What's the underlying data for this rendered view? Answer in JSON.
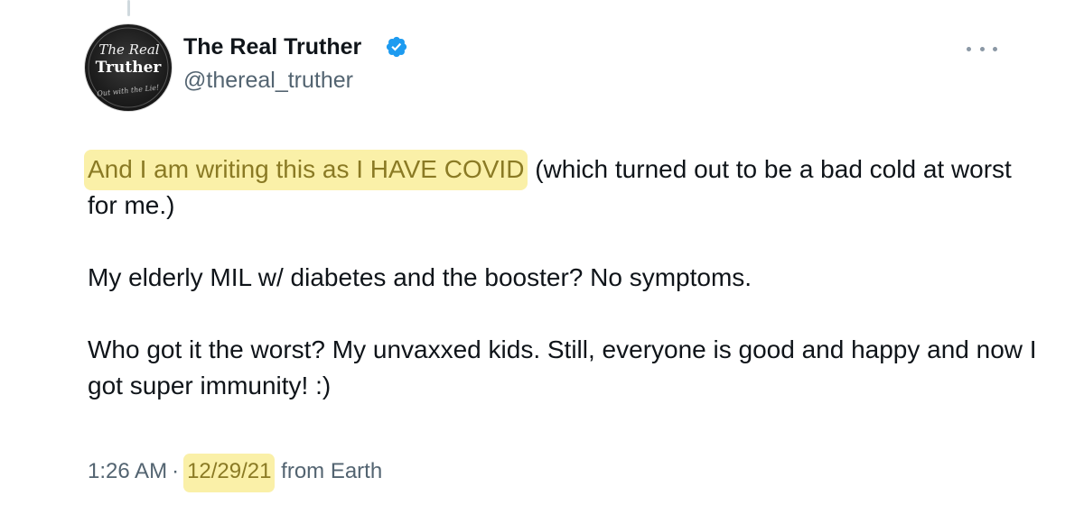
{
  "tweet": {
    "author": {
      "name": "The Real Truther",
      "handle": "@thereal_truther",
      "verified": true,
      "avatar_text_top": "The Real",
      "avatar_text_main": "Truther",
      "avatar_tagline": "Out with the Lie!"
    },
    "menu_icon": "more-horizontal-icon",
    "body": {
      "line1_highlight": "And I am writing this as I HAVE COVID",
      "line1_rest": " (which turned out to be a bad cold at worst for me.)",
      "paragraph2": "My elderly MIL w/ diabetes and the booster? No symptoms.",
      "paragraph3": "Who got it the worst? My unvaxxed kids. Still, everyone is good and happy and now I got super immunity! :)"
    },
    "meta": {
      "time": "1:26 AM",
      "separator": "·",
      "date": "12/29/21",
      "source": " from Earth"
    }
  },
  "colors": {
    "highlight_bg": "#faf0a8",
    "highlight_text": "#8a7a24",
    "verified_blue": "#1d9bf0",
    "secondary_text": "#536471",
    "primary_text": "#0f1419"
  }
}
